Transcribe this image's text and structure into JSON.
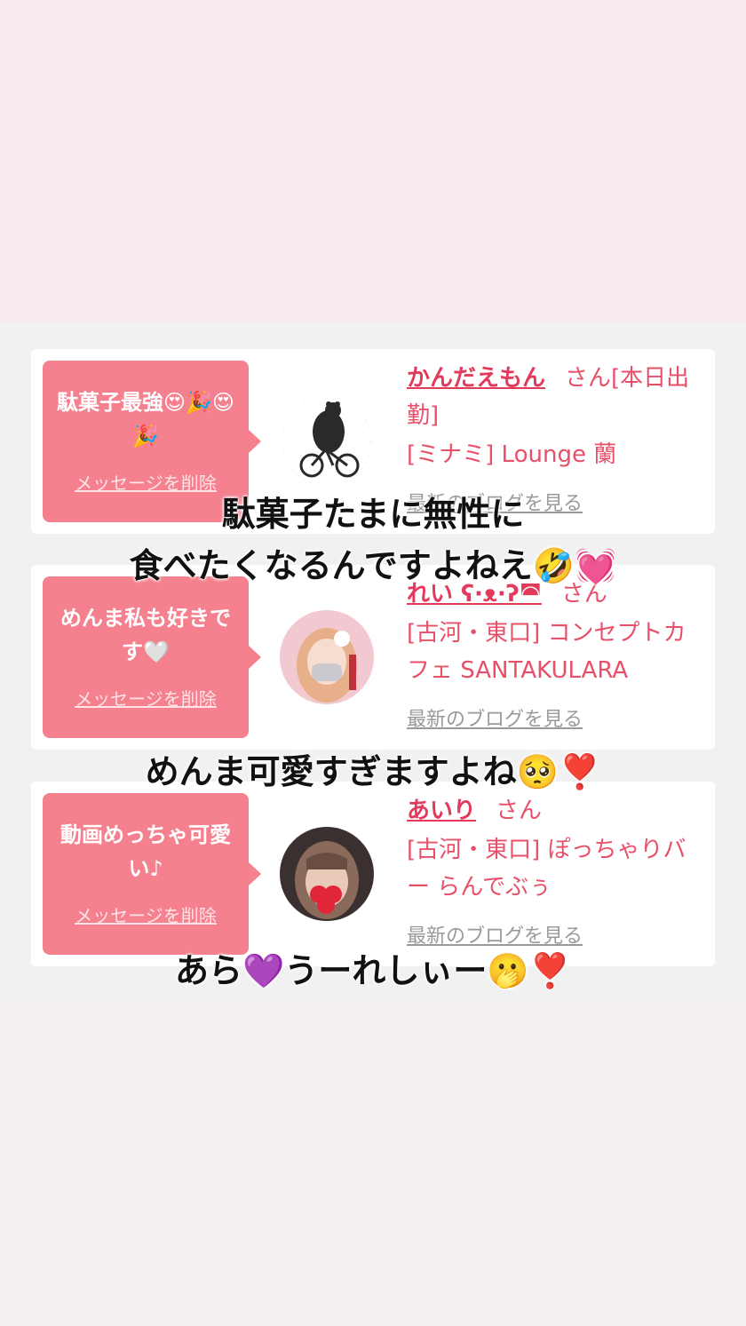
{
  "messages": [
    {
      "bubble_text": "駄菓子最強😍🎉😍🎉",
      "delete_label": "メッセージを削除",
      "name": "かんだえもん",
      "honorific": "さん[本日出勤]",
      "shop": "[ミナミ] Lounge 蘭",
      "blog_label": "最新のブログを見る",
      "avatar": "bear-on-bicycle-icon"
    },
    {
      "bubble_text": "めんま私も好きです🤍",
      "delete_label": "メッセージを削除",
      "name": "れい ʕ·ᴥ·ʔ◚",
      "honorific": "さん",
      "shop": "[古河・東口] コンセプトカフェ SANTAKULARA",
      "blog_label": "最新のブログを見る",
      "avatar": "girl-photo-avatar"
    },
    {
      "bubble_text": "動画めっちゃ可愛い♪",
      "delete_label": "メッセージを削除",
      "name": "あいり",
      "honorific": "さん",
      "shop": "[古河・東口] ぽっちゃりバー らんでぶぅ",
      "blog_label": "最新のブログを見る",
      "avatar": "girl-photo-hearts-avatar"
    }
  ],
  "captions": {
    "c1_line1": "駄菓子たまに無性に",
    "c1_line2": "食べたくなるんですよねえ🤣💓",
    "c2": "めんま可愛すぎますよね🥺❣️",
    "c3": "あら💜うーれしぃー🫢❣️"
  },
  "colors": {
    "bubble": "#f5808e",
    "name": "#e33a5c",
    "text": "#e8506a",
    "top_band": "#f6eaec"
  }
}
